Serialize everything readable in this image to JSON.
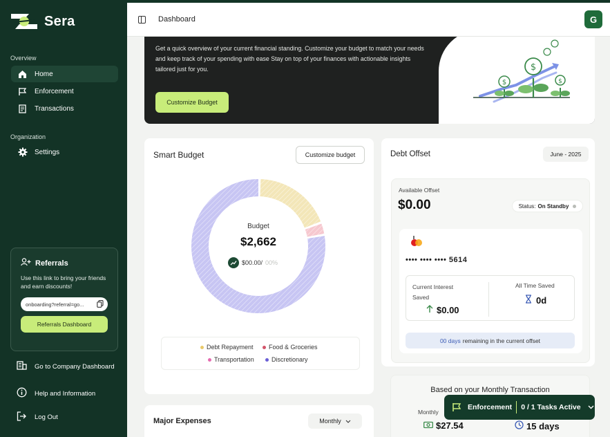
{
  "brand": {
    "name": "Sera"
  },
  "sidebar": {
    "overview_label": "Overview",
    "nav": [
      {
        "label": "Home",
        "icon": "home-icon"
      },
      {
        "label": "Enforcement",
        "icon": "flag-icon"
      },
      {
        "label": "Transactions",
        "icon": "receipt-icon"
      }
    ],
    "organization_label": "Organization",
    "org_nav": [
      {
        "label": "Settings",
        "icon": "gear-icon"
      }
    ],
    "referrals": {
      "title": "Referrals",
      "description": "Use this link to bring your friends and earn discounts!",
      "link": "onboarding?referral=go...",
      "button": "Referrals Dashboard"
    },
    "bottom": [
      {
        "label": "Go to Company Dashboard",
        "icon": "building-icon"
      },
      {
        "label": "Help and Information",
        "icon": "info-icon"
      },
      {
        "label": "Log Out",
        "icon": "logout-icon"
      }
    ]
  },
  "topbar": {
    "title": "Dashboard",
    "avatar_initial": "G"
  },
  "hero": {
    "text": "Get a quick overview of your current financial standing. Customize your budget to match your needs and keep track of your spending with ease Stay on top of your finances with actionable insights tailored just for you.",
    "button": "Customize Budget"
  },
  "smart_budget": {
    "title": "Smart Budget",
    "button": "Customize budget",
    "center_label": "Budget",
    "center_value": "$2,662",
    "spent": "$00.00/",
    "spent_suffix": "00%",
    "legend": [
      {
        "label": "Debt Repayment",
        "color": "#e9c96a"
      },
      {
        "label": "Food & Groceries",
        "color": "#d2556a"
      },
      {
        "label": "Transportation",
        "color": "#e56bb0"
      },
      {
        "label": "Discretionary",
        "color": "#6a5fd6"
      }
    ]
  },
  "chart_data": {
    "type": "pie",
    "labels": [
      "Debt Repayment",
      "Food & Groceries",
      "Discretionary"
    ],
    "values": [
      19,
      3,
      78
    ],
    "colors": [
      "#f3e6b8",
      "#f6c8cf",
      "#c7c5f3"
    ]
  },
  "debt_offset": {
    "title": "Debt Offset",
    "period": "June - 2025",
    "available_label": "Available Offset",
    "available_value": "$0.00",
    "status_prefix": "Status:",
    "status_value": "On Standby",
    "card_number": "•••• •••• •••• 5614",
    "interest_label": "Current Interest Saved",
    "interest_value": "$0.00",
    "all_time_label": "All Time Saved",
    "all_time_value": "0d",
    "remaining_days": "00 days",
    "remaining_text": "remaining in the current offset"
  },
  "monthly": {
    "title": "Based on your Monthly Transaction",
    "label": "Monthly",
    "amount": "$27.54",
    "days": "15 days"
  },
  "major_expenses": {
    "title": "Major Expenses",
    "period": "Monthly"
  },
  "toast": {
    "label": "Enforcement",
    "tasks": "0 / 1 Tasks Active"
  }
}
